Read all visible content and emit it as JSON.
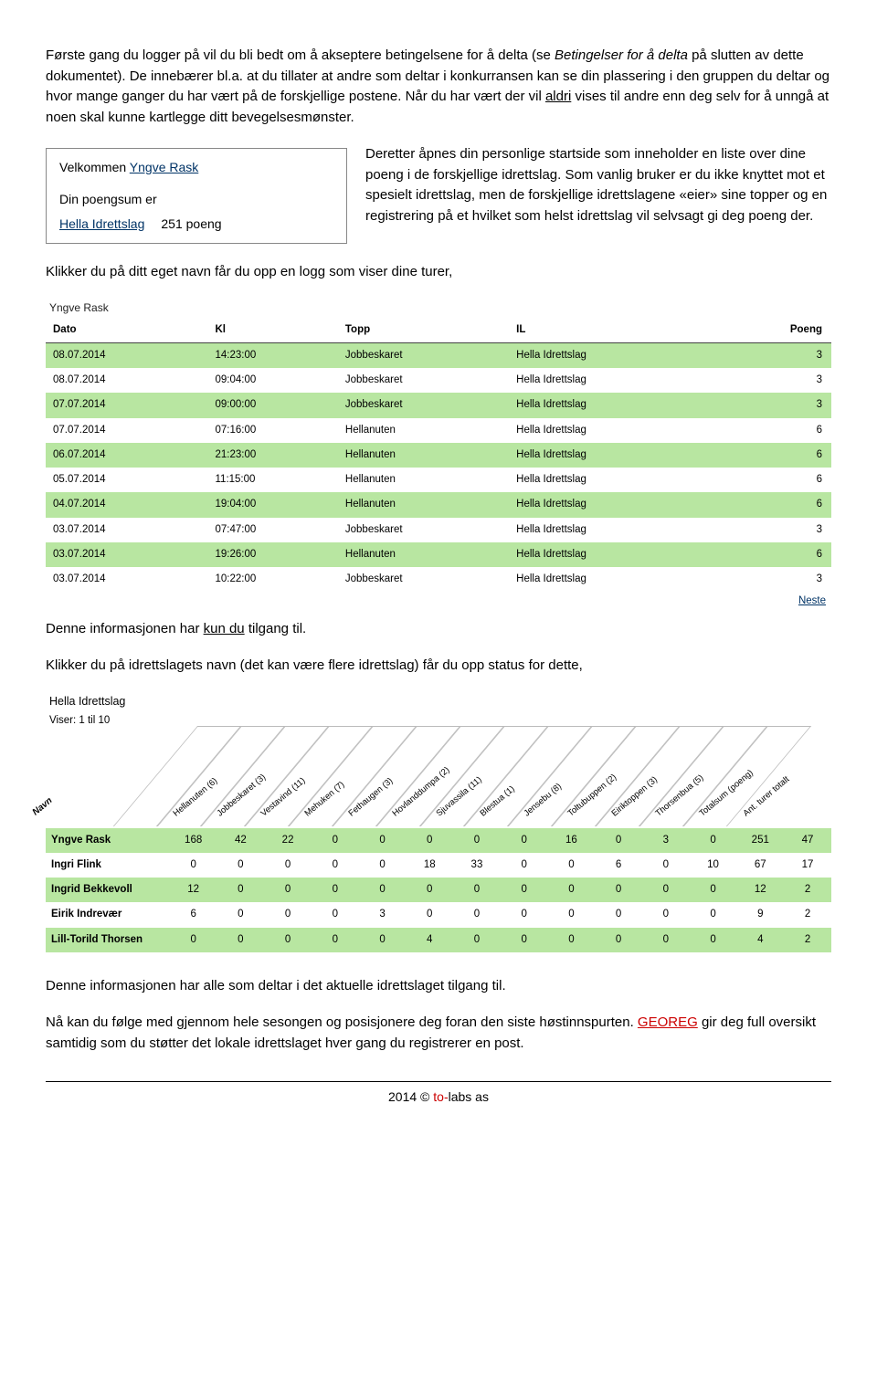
{
  "para1a": "Første gang du logger på vil du bli bedt om å akseptere betingelsene for å delta (se ",
  "para1b": "Betingelser for å delta",
  "para1c": " på slutten av dette dokumentet). De innebærer bl.a. at du tillater at andre som deltar i konkurransen kan se din plassering i den gruppen du deltar og hvor mange ganger du har vært på de forskjellige postene. Når du har vært der vil ",
  "para1d": "aldri",
  "para1e": " vises til andre enn deg selv for å unngå at noen skal kunne kartlegge ditt bevegelsesmønster.",
  "inset": {
    "welcome_prefix": "Velkommen ",
    "welcome_name": "Yngve Rask",
    "score_label": "Din poengsum er",
    "team": "Hella Idrettslag",
    "points": "251 poeng"
  },
  "para2": "Deretter åpnes din personlige startside som inneholder en liste over dine poeng i de forskjellige idrettslag. Som vanlig bruker er du ikke knyttet mot et spesielt idrettslag, men de forskjellige idrettslagene «eier» sine topper og en registrering på et hvilket som helst idrettslag vil selvsagt gi deg poeng der.",
  "para3": "Klikker du på ditt eget navn får du opp en logg som viser dine turer,",
  "log": {
    "owner": "Yngve Rask",
    "headers": [
      "Dato",
      "Kl",
      "Topp",
      "IL",
      "Poeng"
    ],
    "rows": [
      {
        "d": "08.07.2014",
        "t": "14:23:00",
        "topp": "Jobbeskaret",
        "il": "Hella Idrettslag",
        "p": "3",
        "alt": true
      },
      {
        "d": "08.07.2014",
        "t": "09:04:00",
        "topp": "Jobbeskaret",
        "il": "Hella Idrettslag",
        "p": "3",
        "alt": false
      },
      {
        "d": "07.07.2014",
        "t": "09:00:00",
        "topp": "Jobbeskaret",
        "il": "Hella Idrettslag",
        "p": "3",
        "alt": true
      },
      {
        "d": "07.07.2014",
        "t": "07:16:00",
        "topp": "Hellanuten",
        "il": "Hella Idrettslag",
        "p": "6",
        "alt": false
      },
      {
        "d": "06.07.2014",
        "t": "21:23:00",
        "topp": "Hellanuten",
        "il": "Hella Idrettslag",
        "p": "6",
        "alt": true
      },
      {
        "d": "05.07.2014",
        "t": "11:15:00",
        "topp": "Hellanuten",
        "il": "Hella Idrettslag",
        "p": "6",
        "alt": false
      },
      {
        "d": "04.07.2014",
        "t": "19:04:00",
        "topp": "Hellanuten",
        "il": "Hella Idrettslag",
        "p": "6",
        "alt": true
      },
      {
        "d": "03.07.2014",
        "t": "07:47:00",
        "topp": "Jobbeskaret",
        "il": "Hella Idrettslag",
        "p": "3",
        "alt": false
      },
      {
        "d": "03.07.2014",
        "t": "19:26:00",
        "topp": "Hellanuten",
        "il": "Hella Idrettslag",
        "p": "6",
        "alt": true
      },
      {
        "d": "03.07.2014",
        "t": "10:22:00",
        "topp": "Jobbeskaret",
        "il": "Hella Idrettslag",
        "p": "3",
        "alt": false
      }
    ],
    "next": "Neste"
  },
  "para4a": "Denne informasjonen har ",
  "para4b": "kun du",
  "para4c": " tilgang til.",
  "para5": "Klikker du på idrettslagets navn (det kan være flere idrettslag) får du opp status for dette,",
  "stat": {
    "team": "Hella Idrettslag",
    "viser": "Viser: 1 til 10",
    "navn_header": "Navn",
    "col_labels": [
      "Hellanuten (6)",
      "Jobbeskaret (3)",
      "Vestavind (11)",
      "Mehuken (7)",
      "Fethaugen (3)",
      "Hovlanddumpa (2)",
      "Sjuvassila (11)",
      "Blestua (1)",
      "Jensebu (8)",
      "Toltubuppen (2)",
      "Eiriktoppen (3)",
      "Thorsenbua (5)",
      "Totalsum (poeng)",
      "Ant. turer totalt"
    ],
    "rows": [
      {
        "name": "Yngve Rask",
        "v": [
          "168",
          "42",
          "22",
          "0",
          "0",
          "0",
          "0",
          "0",
          "16",
          "0",
          "3",
          "0",
          "251",
          "47"
        ],
        "g": true
      },
      {
        "name": "Ingri Flink",
        "v": [
          "0",
          "0",
          "0",
          "0",
          "0",
          "18",
          "33",
          "0",
          "0",
          "6",
          "0",
          "10",
          "67",
          "17"
        ],
        "g": false
      },
      {
        "name": "Ingrid Bekkevoll",
        "v": [
          "12",
          "0",
          "0",
          "0",
          "0",
          "0",
          "0",
          "0",
          "0",
          "0",
          "0",
          "0",
          "12",
          "2"
        ],
        "g": true
      },
      {
        "name": "Eirik Indrevær",
        "v": [
          "6",
          "0",
          "0",
          "0",
          "3",
          "0",
          "0",
          "0",
          "0",
          "0",
          "0",
          "0",
          "9",
          "2"
        ],
        "g": false
      },
      {
        "name": "Lill-Torild Thorsen",
        "v": [
          "0",
          "0",
          "0",
          "0",
          "0",
          "4",
          "0",
          "0",
          "0",
          "0",
          "0",
          "0",
          "4",
          "2"
        ],
        "g": true
      }
    ]
  },
  "para6": "Denne informasjonen har alle som deltar i det aktuelle idrettslaget tilgang til.",
  "para7a": "Nå kan du følge med gjennom hele sesongen og posisjonere deg foran den siste høstinnspurten. ",
  "para7b": "GEOREG",
  "para7c": " gir deg full oversikt samtidig som du støtter det lokale idrettslaget hver gang du registrerer en post.",
  "footer": {
    "year": "2014 © ",
    "brand_red": "to-",
    "brand_rest": "labs as"
  }
}
